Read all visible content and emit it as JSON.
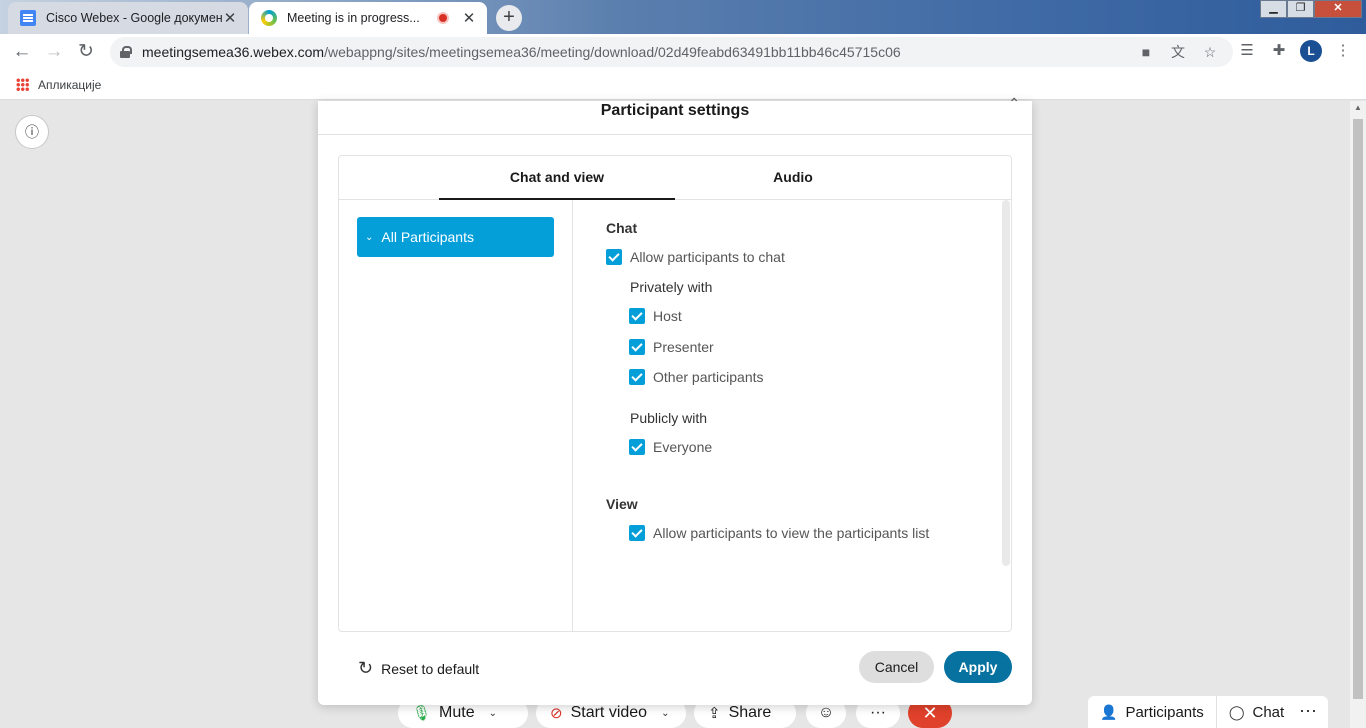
{
  "browser": {
    "tabs": [
      {
        "title": "Cisco Webex - Google документ",
        "icon": "docs-icon",
        "active": false
      },
      {
        "title": "Meeting is in progress...",
        "icon": "webex-icon",
        "active": true,
        "recording": true
      }
    ],
    "url_host": "meetingsemea36.webex.com",
    "url_path": "/webappng/sites/meetingsemea36/meeting/download/02d49feabd63491bb11bb46c45715c06",
    "profile_initial": "L",
    "bookmarks": [
      {
        "label": "Апликације",
        "icon": "apps-grid-icon"
      }
    ]
  },
  "modal": {
    "title": "Participant settings",
    "tabs": [
      {
        "label": "Chat and view",
        "selected": true
      },
      {
        "label": "Audio",
        "selected": false
      }
    ],
    "role_list": [
      {
        "label": "All Participants",
        "selected": true
      }
    ],
    "chat": {
      "title": "Chat",
      "allow_label": "Allow participants to chat",
      "allow_checked": true,
      "privately_title": "Privately with",
      "privately": [
        {
          "label": "Host",
          "checked": true
        },
        {
          "label": "Presenter",
          "checked": true
        },
        {
          "label": "Other participants",
          "checked": true
        }
      ],
      "publicly_title": "Publicly with",
      "publicly": [
        {
          "label": "Everyone",
          "checked": true
        }
      ]
    },
    "view": {
      "title": "View",
      "allow_list_label": "Allow participants to view the participants list",
      "allow_list_checked": true
    },
    "reset_label": "Reset to default",
    "cancel_label": "Cancel",
    "apply_label": "Apply"
  },
  "controls": {
    "mute_label": "Mute",
    "video_label": "Start video",
    "share_label": "Share",
    "more_label": "···",
    "participants_label": "Participants",
    "chat_label": "Chat",
    "more2_label": "···"
  },
  "colors": {
    "accent": "#049fd9",
    "apply": "#07729f",
    "end_call": "#e0412b"
  }
}
